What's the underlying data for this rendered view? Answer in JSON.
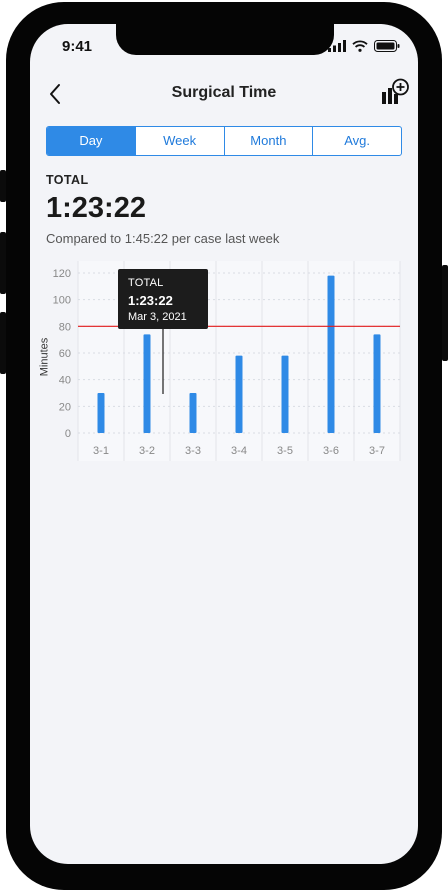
{
  "status_bar": {
    "time": "9:41"
  },
  "header": {
    "title": "Surgical Time"
  },
  "tabs": [
    {
      "label": "Day",
      "active": true
    },
    {
      "label": "Week",
      "active": false
    },
    {
      "label": "Month",
      "active": false
    },
    {
      "label": "Avg.",
      "active": false
    }
  ],
  "summary": {
    "label": "TOTAL",
    "value": "1:23:22",
    "comparison": "Compared to 1:45:22 per case last week"
  },
  "tooltip": {
    "title": "TOTAL",
    "value": "1:23:22",
    "date": "Mar 3, 2021"
  },
  "colors": {
    "accent": "#2f8ae6",
    "reference_line": "#e21b1b",
    "tooltip_bg": "#1c1c1c"
  },
  "chart_data": {
    "type": "bar",
    "categories": [
      "3-1",
      "3-2",
      "3-3",
      "3-4",
      "3-5",
      "3-6",
      "3-7"
    ],
    "values": [
      30,
      74,
      30,
      58,
      58,
      118,
      74
    ],
    "ylabel": "Minutes",
    "ylim": [
      0,
      120
    ],
    "yticks": [
      0,
      20,
      40,
      60,
      80,
      100,
      120
    ],
    "reference_line": 80,
    "grid": true
  }
}
